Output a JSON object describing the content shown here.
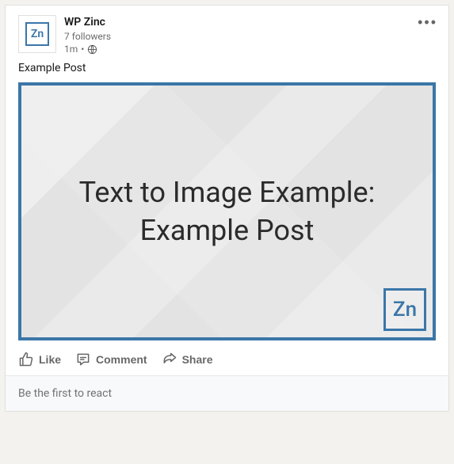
{
  "author": {
    "name": "WP Zinc",
    "avatar_text": "Zn",
    "followers": "7 followers",
    "timestamp": "1m",
    "separator": "•"
  },
  "menu_label": "•••",
  "post_text": "Example Post",
  "image": {
    "line1": "Text to Image Example:",
    "line2": "Example Post",
    "badge": "Zn"
  },
  "actions": {
    "like": "Like",
    "comment": "Comment",
    "share": "Share"
  },
  "react_prompt": "Be the first to react"
}
